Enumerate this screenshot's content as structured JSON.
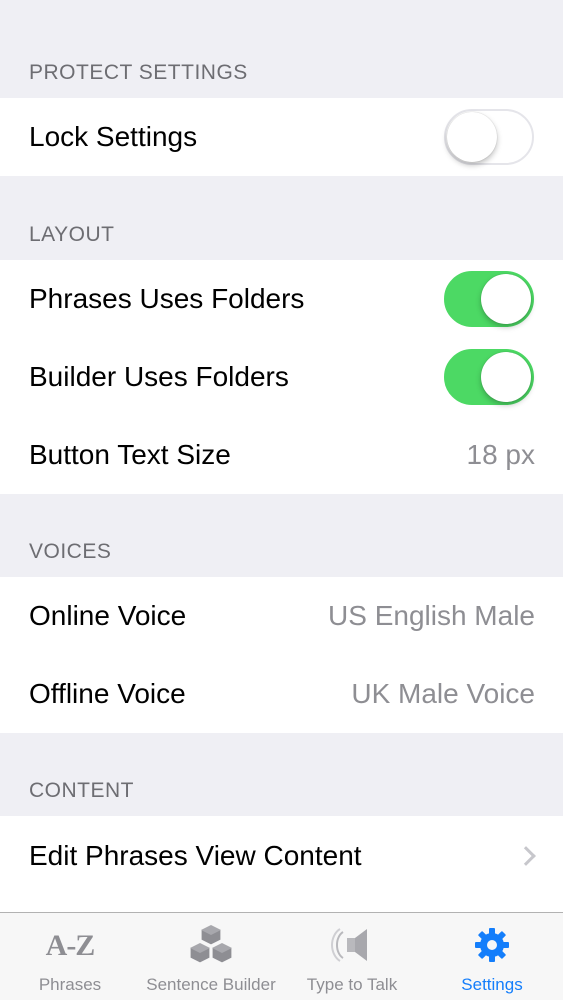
{
  "sections": {
    "protect": {
      "header": "PROTECT SETTINGS"
    },
    "layout": {
      "header": "LAYOUT"
    },
    "voices": {
      "header": "VOICES"
    },
    "content": {
      "header": "CONTENT"
    }
  },
  "rows": {
    "lock_settings": {
      "label": "Lock Settings",
      "toggle_on": false
    },
    "phrases_folders": {
      "label": "Phrases Uses Folders",
      "toggle_on": true
    },
    "builder_folders": {
      "label": "Builder Uses Folders",
      "toggle_on": true
    },
    "button_text_size": {
      "label": "Button Text Size",
      "value": "18 px"
    },
    "online_voice": {
      "label": "Online Voice",
      "value": "US English Male"
    },
    "offline_voice": {
      "label": "Offline Voice",
      "value": "UK Male Voice"
    },
    "edit_phrases": {
      "label": "Edit Phrases View Content",
      "icon": "chevron-right-icon"
    }
  },
  "tabbar": {
    "tabs": [
      {
        "label": "Phrases",
        "icon": "az-icon",
        "active": false
      },
      {
        "label": "Sentence Builder",
        "icon": "cubes-icon",
        "active": false
      },
      {
        "label": "Type to Talk",
        "icon": "speaker-icon",
        "active": false
      },
      {
        "label": "Settings",
        "icon": "gear-icon",
        "active": true
      }
    ]
  },
  "colors": {
    "background": "#efeff4",
    "toggle_on": "#4cd964",
    "active_tab": "#147efb",
    "inactive_tab": "#8e8e93",
    "secondary_text": "#8e8e93"
  }
}
